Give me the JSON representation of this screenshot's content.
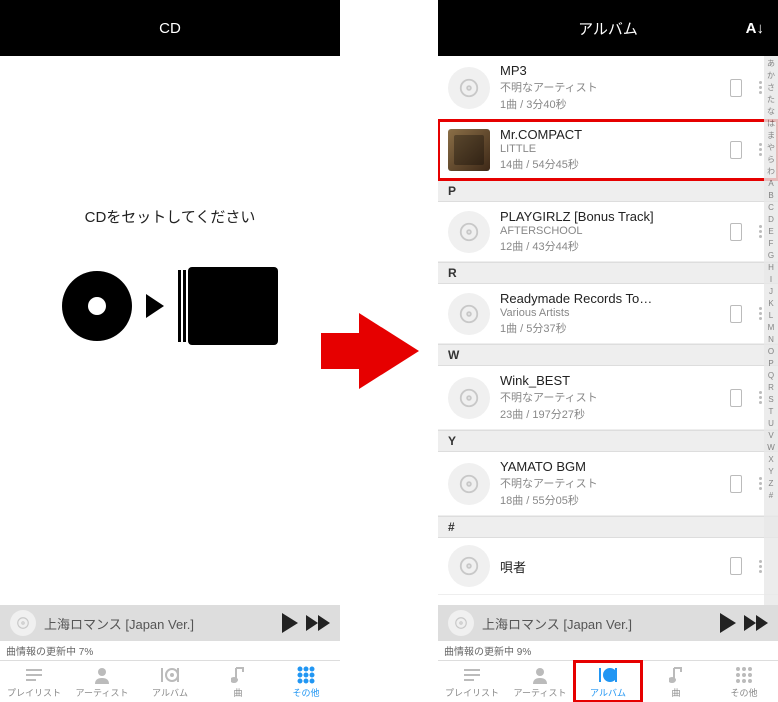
{
  "left": {
    "header": "CD",
    "message": "CDをセットしてください",
    "player_title": "上海ロマンス [Japan Ver.]",
    "status": "曲情報の更新中 7%",
    "tabs": [
      "プレイリスト",
      "アーティスト",
      "アルバム",
      "曲",
      "その他"
    ]
  },
  "right": {
    "header": "アルバム",
    "sort": "A↓",
    "items": [
      {
        "title": "MP3",
        "artist": "不明なアーティスト",
        "meta": "1曲 / 3分40秒",
        "sec": null,
        "img": false,
        "hl": false
      },
      {
        "title": "Mr.COMPACT",
        "artist": "LITTLE",
        "meta": "14曲 / 54分45秒",
        "sec": null,
        "img": true,
        "hl": true
      },
      {
        "sec": "P"
      },
      {
        "title": "PLAYGIRLZ [Bonus Track]",
        "artist": "AFTERSCHOOL",
        "meta": "12曲 / 43分44秒",
        "sec": null,
        "img": false,
        "hl": false
      },
      {
        "sec": "R"
      },
      {
        "title": "Readymade Records To…",
        "artist": "Various Artists",
        "meta": "1曲 / 5分37秒",
        "sec": null,
        "img": false,
        "hl": false
      },
      {
        "sec": "W"
      },
      {
        "title": "Wink_BEST",
        "artist": "不明なアーティスト",
        "meta": "23曲 / 197分27秒",
        "sec": null,
        "img": false,
        "hl": false
      },
      {
        "sec": "Y"
      },
      {
        "title": "YAMATO BGM",
        "artist": "不明なアーティスト",
        "meta": "18曲 / 55分05秒",
        "sec": null,
        "img": false,
        "hl": false
      },
      {
        "sec": "#"
      },
      {
        "title": "唄者",
        "artist": "",
        "meta": "",
        "sec": null,
        "img": false,
        "hl": false
      }
    ],
    "index": [
      "あ",
      "か",
      "さ",
      "た",
      "な",
      "は",
      "ま",
      "や",
      "ら",
      "わ",
      "A",
      "B",
      "C",
      "D",
      "E",
      "F",
      "G",
      "H",
      "I",
      "J",
      "K",
      "L",
      "M",
      "N",
      "O",
      "P",
      "Q",
      "R",
      "S",
      "T",
      "U",
      "V",
      "W",
      "X",
      "Y",
      "Z",
      "#"
    ],
    "player_title": "上海ロマンス [Japan Ver.]",
    "status": "曲情報の更新中 9%",
    "tabs": [
      "プレイリスト",
      "アーティスト",
      "アルバム",
      "曲",
      "その他"
    ]
  }
}
